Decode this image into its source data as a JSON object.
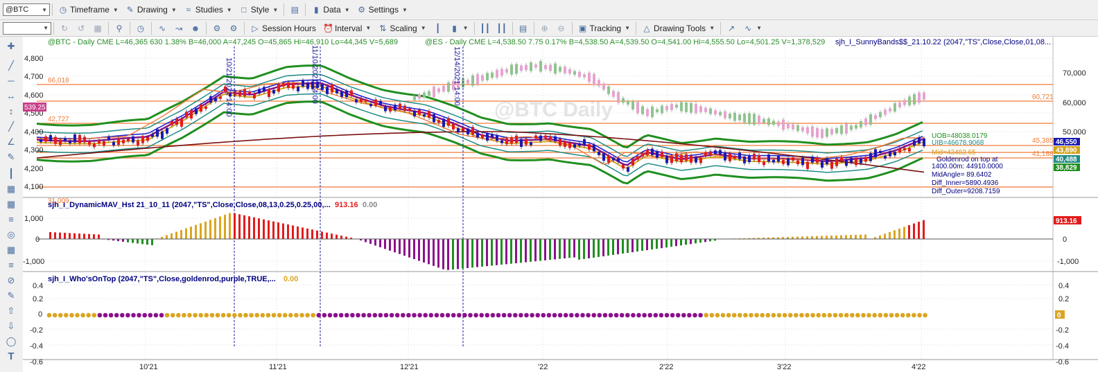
{
  "toolbar1": {
    "symbol": "@BTC",
    "items": [
      "Timeframe",
      "Drawing",
      "Studies",
      "Style",
      "Data",
      "Settings"
    ]
  },
  "toolbar2": {
    "interval_field": "",
    "session_hours": "Session Hours",
    "interval": "Interval",
    "scaling": "Scaling",
    "tracking": "Tracking",
    "drawing_tools": "Drawing Tools"
  },
  "header": {
    "btc": "@BTC - Daily  CME  L=46,365  630  1.38%  B=46,000  A=47,245  O=45,865  Hi=46,910  Lo=44,345  V=5,689",
    "es": "@ES - Daily  CME  L=4,538.50  7.75  0.17%  B=4,538.50  A=4,539.50  O=4,541.00  Hi=4,555.50  Lo=4,501.25  V=1,378,529",
    "study": "sjh_I_SunnyBands$$_21.10.22 (2047,\"TS\",Close,Close,01,08..."
  },
  "colors": {
    "up": "#2a8d2a",
    "down": "#e31b1b",
    "goldenrod": "#daa520",
    "purple": "#8b108b",
    "orange_line": "#f07a38",
    "blue_dash": "#1a1aa0",
    "grid": "#d8d8d8"
  },
  "main_pane": {
    "left_axis": [
      "4,800",
      "4,700",
      "4,600",
      "4,500",
      "4,400",
      "4,300",
      "4,200",
      "4,100"
    ],
    "right_axis": [
      "70,000",
      "60,000",
      "50,000"
    ],
    "left_price_tag": "539.25",
    "left_line_labels": [
      "66,018",
      "42,727",
      "31,009"
    ],
    "right_line_labels": [
      "60,721",
      "45,385",
      "41,188"
    ],
    "right_tags": [
      {
        "text": "46,550",
        "bg": "#1a1ab4"
      },
      {
        "text": "43,890",
        "bg": "#d4a017"
      },
      {
        "text": "40,488",
        "bg": "#1f8c86"
      },
      {
        "text": "38,829",
        "bg": "#1f8f1f"
      }
    ],
    "vertical_labels": [
      "10/21/2021 14:00",
      "11/10/2021 14:00",
      "12/14/2021 14:00"
    ],
    "watermark": "@BTC Daily",
    "annotations": [
      {
        "text": "UOB=48038.0179",
        "color": "#1f8f1f"
      },
      {
        "text": "UIB=46678.9068",
        "color": "#1f8c86"
      },
      {
        "text": "Mid=43483.65",
        "color": "#d4a017"
      },
      {
        "text": "Goldenrod on top at",
        "color": "#000080"
      },
      {
        "text": "1400.00m: 44910.0000",
        "color": "#000080"
      },
      {
        "text": "MidAngle= 89.6402",
        "color": "#000080"
      },
      {
        "text": "Diff_Inner=5890.4936",
        "color": "#000080"
      },
      {
        "text": "Diff_Outer=9208.7159",
        "color": "#000080"
      }
    ]
  },
  "hist_pane": {
    "title": "sjh_I_DynamicMAV_Hst 21_10_11 (2047,\"TS\",Close,Close,08,13,0.25,0.25,00,...",
    "value": "913.16",
    "value2": "0.00",
    "left_axis": [
      "1,000",
      "0",
      "-1,000"
    ],
    "right_axis": [
      "0",
      "-1,000"
    ],
    "tag": "913.16"
  },
  "who_pane": {
    "title": "sjh_I_Who'sOnTop (2047,\"TS\",Close,goldenrod,purple,TRUE,...",
    "value": "0.00",
    "left_axis": [
      "0.4",
      "0.2",
      "0",
      "-0.2",
      "-0.4",
      "-0.6"
    ],
    "right_axis": [
      "0.4",
      "0.2",
      "-0.2",
      "-0.4",
      "-0.6"
    ],
    "tag": "0"
  },
  "x_axis": [
    "10'21",
    "11'21",
    "12'21",
    "'22",
    "2'22",
    "3'22",
    "4'22"
  ],
  "chart_data": {
    "type": "candlestick",
    "title": "@BTC - Daily",
    "ylim_es": [
      4080,
      4860
    ],
    "ylim_btc": [
      30000,
      78000
    ],
    "horizontal_levels_btc": [
      66018,
      60721,
      52000,
      45385,
      42727,
      41188,
      31009
    ],
    "vertical_markers": [
      "10/21/2021 14:00",
      "11/10/2021 14:00",
      "12/14/2021 14:00"
    ],
    "histogram_ylim": [
      -1500,
      1500
    ],
    "dots_ylim": [
      -0.7,
      0.5
    ]
  }
}
